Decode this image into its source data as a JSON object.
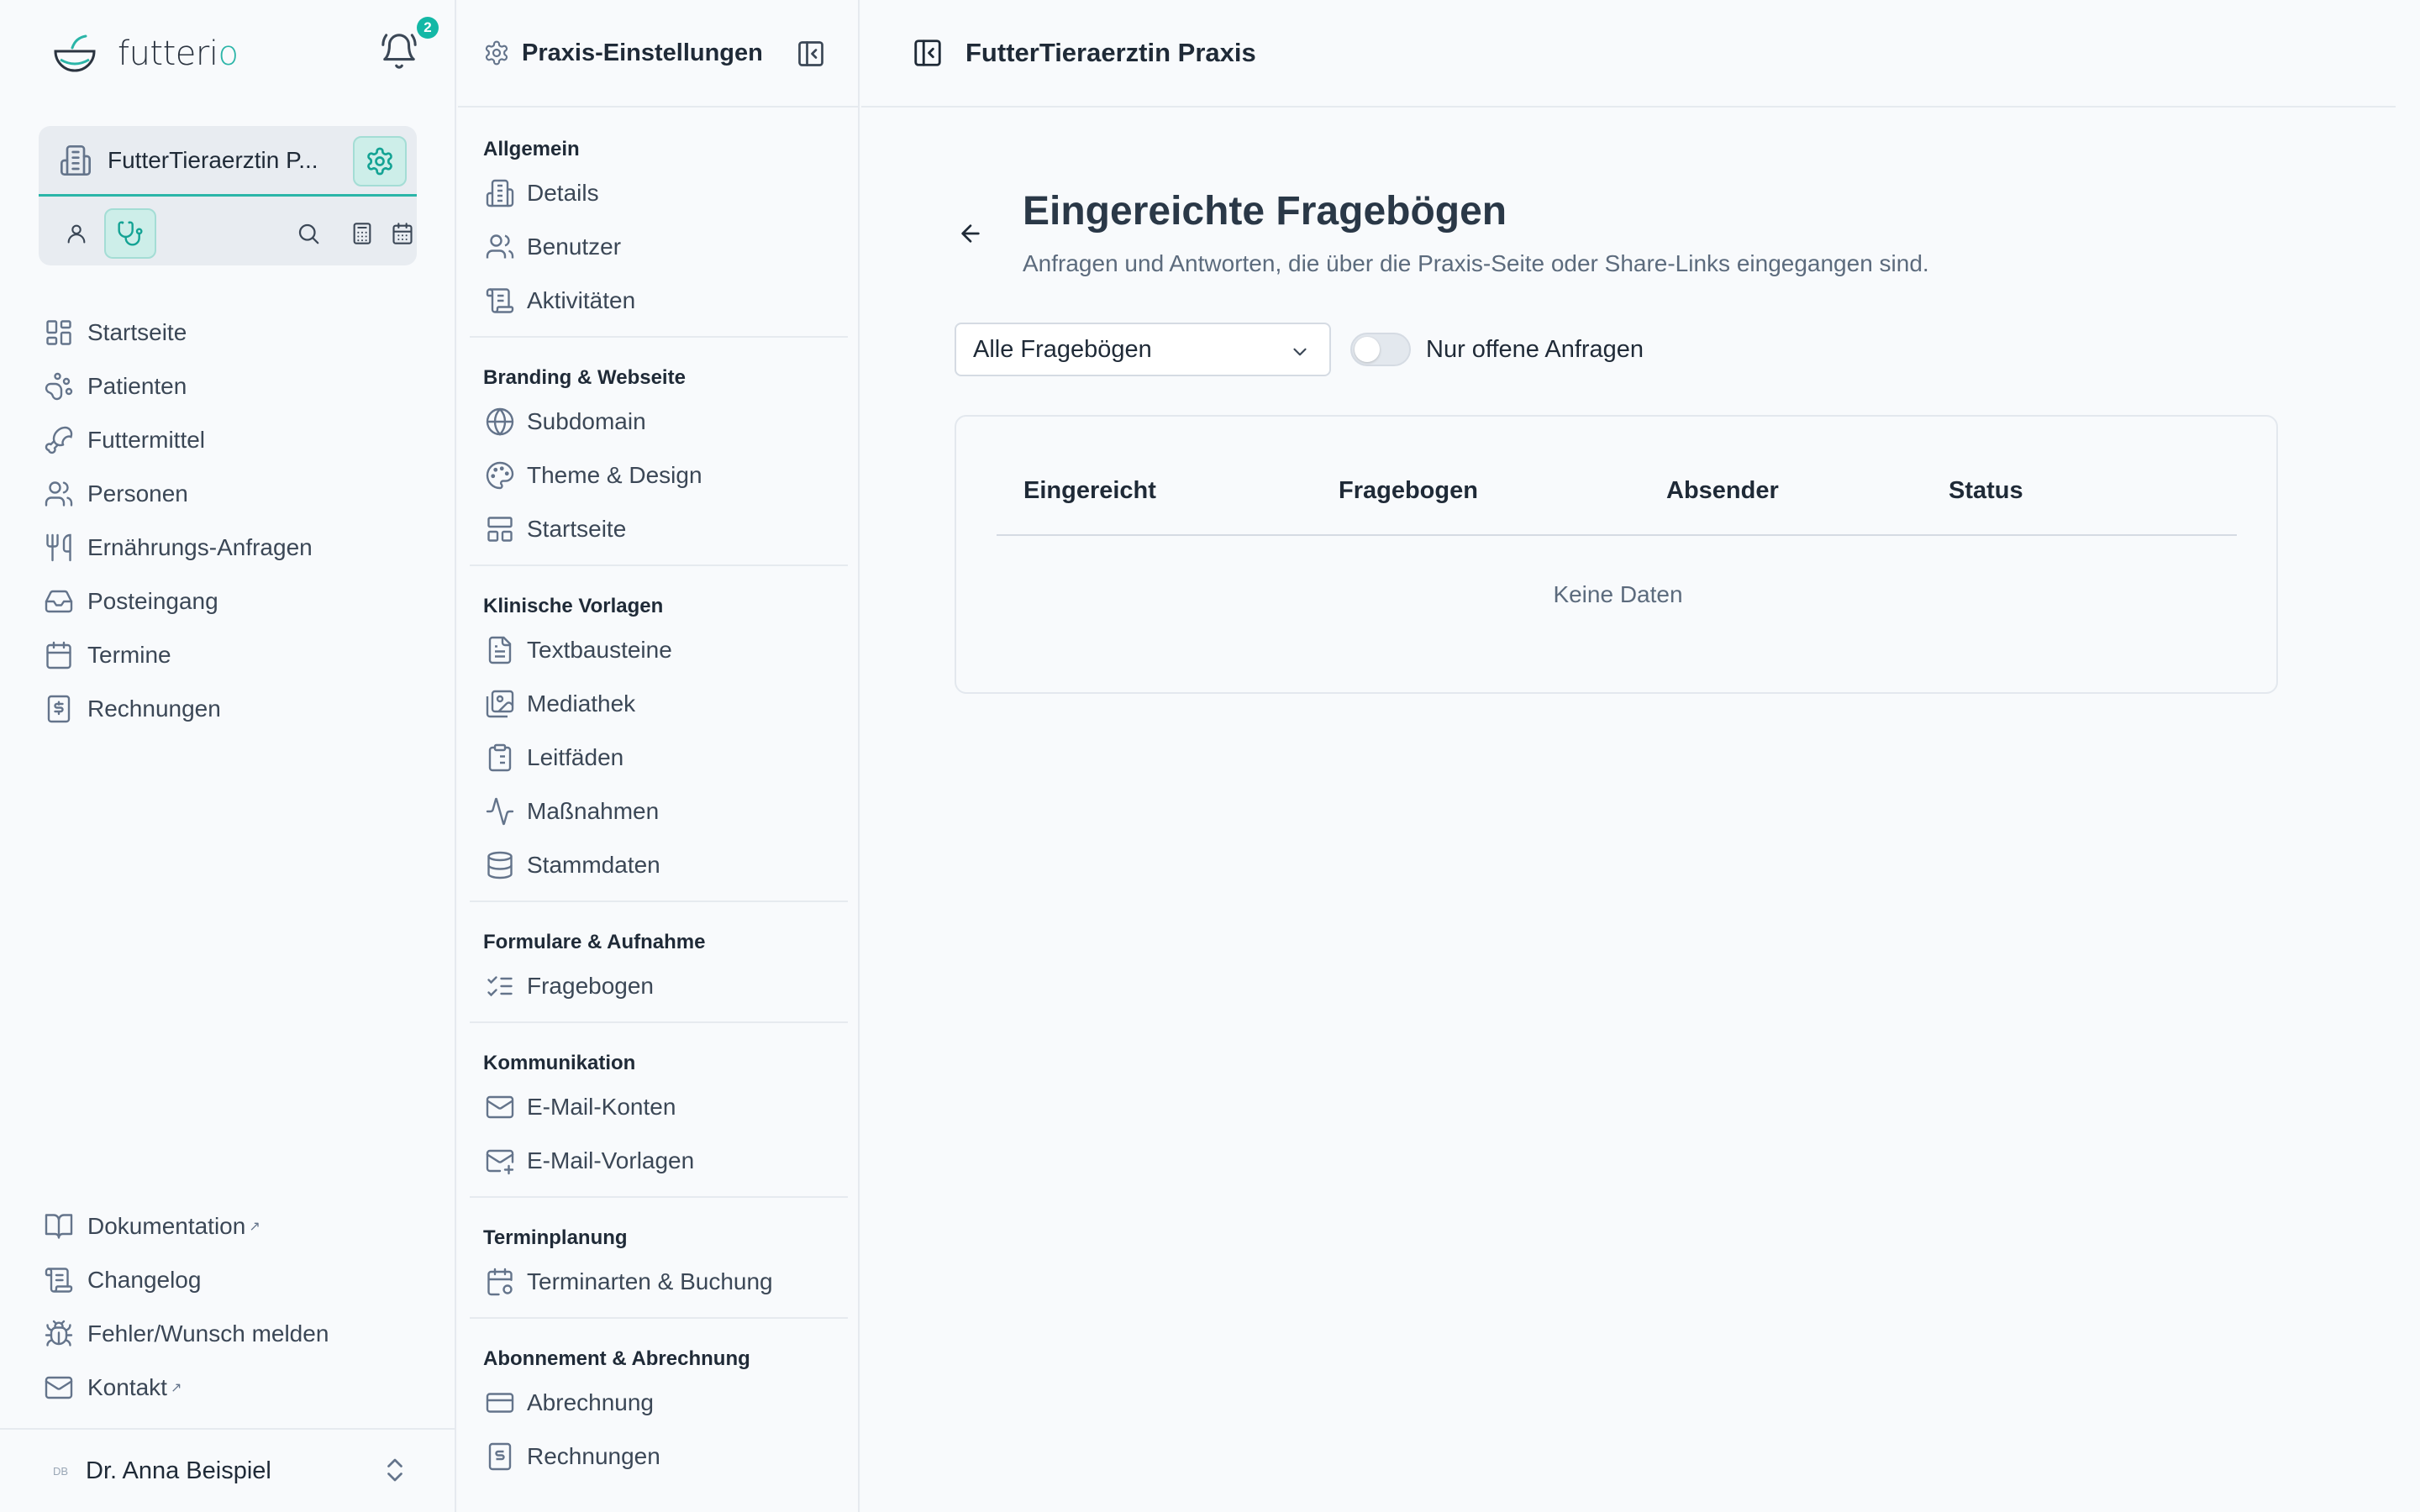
{
  "app": {
    "logo_text_a": "futteri",
    "logo_text_b": "o",
    "notifications_count": "2"
  },
  "practice": {
    "name": "FutterTieraerztin P..."
  },
  "nav": {
    "items": [
      {
        "label": "Startseite"
      },
      {
        "label": "Patienten"
      },
      {
        "label": "Futtermittel"
      },
      {
        "label": "Personen"
      },
      {
        "label": "Ernährungs-Anfragen"
      },
      {
        "label": "Posteingang"
      },
      {
        "label": "Termine"
      },
      {
        "label": "Rechnungen"
      }
    ],
    "bottom_items": [
      {
        "label": "Dokumentation"
      },
      {
        "label": "Changelog"
      },
      {
        "label": "Fehler/Wunsch melden"
      },
      {
        "label": "Kontakt"
      }
    ]
  },
  "user": {
    "initials": "DB",
    "name": "Dr. Anna Beispiel"
  },
  "settings": {
    "title": "Praxis-Einstellungen",
    "sections": [
      {
        "title": "Allgemein",
        "items": [
          "Details",
          "Benutzer",
          "Aktivitäten"
        ]
      },
      {
        "title": "Branding & Webseite",
        "items": [
          "Subdomain",
          "Theme & Design",
          "Startseite"
        ]
      },
      {
        "title": "Klinische Vorlagen",
        "items": [
          "Textbausteine",
          "Mediathek",
          "Leitfäden",
          "Maßnahmen",
          "Stammdaten"
        ]
      },
      {
        "title": "Formulare & Aufnahme",
        "items": [
          "Fragebogen"
        ]
      },
      {
        "title": "Kommunikation",
        "items": [
          "E-Mail-Konten",
          "E-Mail-Vorlagen"
        ]
      },
      {
        "title": "Terminplanung",
        "items": [
          "Terminarten & Buchung"
        ]
      },
      {
        "title": "Abonnement & Abrechnung",
        "items": [
          "Abrechnung",
          "Rechnungen"
        ]
      }
    ]
  },
  "header": {
    "title": "FutterTieraerztin Praxis"
  },
  "page": {
    "title": "Eingereichte Fragebögen",
    "subtitle": "Anfragen und Antworten, die über die Praxis-Seite oder Share-Links eingegangen sind.",
    "filter_value": "Alle Fragebögen",
    "toggle_label": "Nur offene Anfragen",
    "toggle_on": false,
    "columns": [
      "Eingereicht",
      "Fragebogen",
      "Absender",
      "Status"
    ],
    "empty_text": "Keine Daten"
  },
  "colors": {
    "accent": "#14b8a6",
    "text": "#1f2a37",
    "muted": "#5c6b7d"
  }
}
